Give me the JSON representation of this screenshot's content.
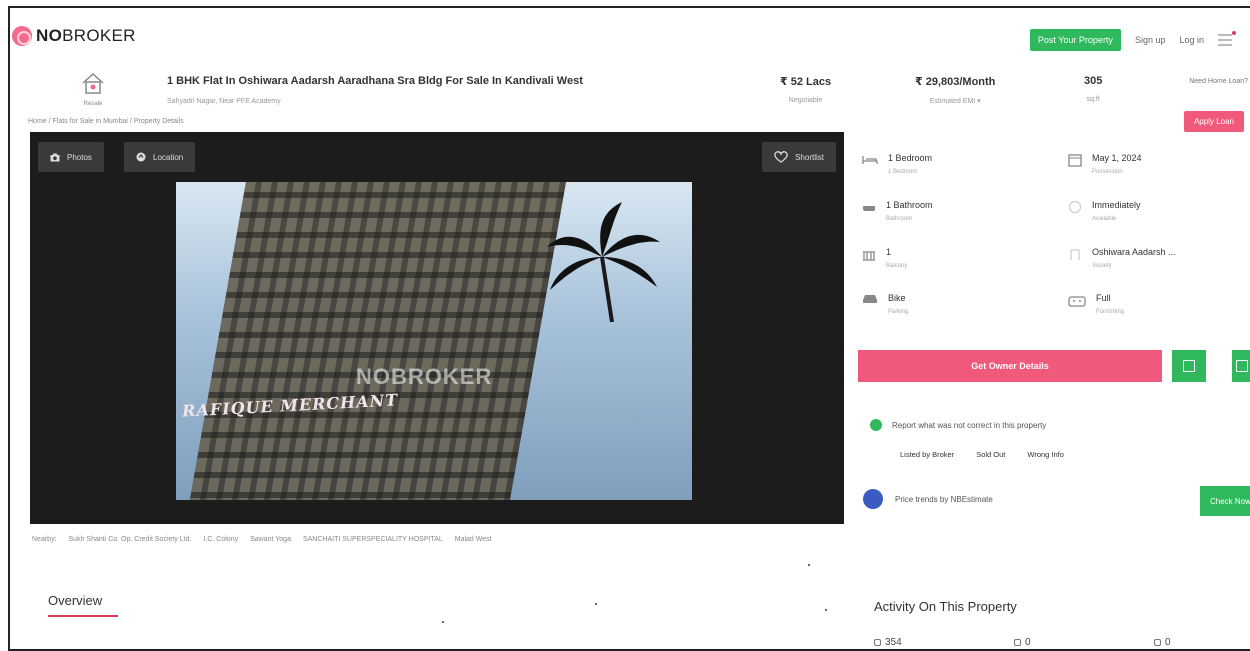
{
  "header": {
    "logo_bold": "NO",
    "logo_rest": "BROKER",
    "post_property": "Post Your Property",
    "sign_up": "Sign up",
    "log_in": "Log in"
  },
  "property": {
    "home_label": "Resale",
    "title": "1 BHK Flat In Oshiwara Aadarsh Aaradhana Sra Bldg For Sale In Kandivali West",
    "subtitle": "Sahyadri Nagar, Near PFE Academy",
    "price": "₹ 52 Lacs",
    "price_sub": "Negotiable",
    "emi": "₹ 29,803/Month",
    "emi_sub": "Estimated EMI ▾",
    "area": "305",
    "area_sub": "sq.ft",
    "loan_question": "Need Home Loan?",
    "apply_loan": "Apply Loan"
  },
  "breadcrumb": "Home / Flats for Sale in Mumbai / Property Details",
  "gallery": {
    "photos": "Photos",
    "location": "Location",
    "shortlist": "Shortlist",
    "watermark": "NOBROKER",
    "signature": "RAFIQUE MERCHANT"
  },
  "nearby": {
    "label": "Nearby:",
    "items": [
      "Sukh Shanti Co. Op. Credit Society Ltd.",
      "I.C. Colony",
      "Sawant Yoga",
      "SANCHAITI SUPERSPECIALITY HOSPITAL",
      "Malad West"
    ]
  },
  "overview": "Overview",
  "features": [
    {
      "title": "1 Bedroom",
      "sub": "1 Bedroom"
    },
    {
      "title": "May 1, 2024",
      "sub": "Possession"
    },
    {
      "title": "1 Bathroom",
      "sub": "Bathroom"
    },
    {
      "title": "Immediately",
      "sub": "Available"
    },
    {
      "title": "1",
      "sub": "Balcony"
    },
    {
      "title": "Oshiwara Aadarsh ...",
      "sub": "Society"
    },
    {
      "title": "Bike",
      "sub": "Parking"
    },
    {
      "title": "Full",
      "sub": "Furnishing"
    }
  ],
  "actions": {
    "owner_details": "Get Owner Details"
  },
  "report": {
    "text": "Report what was not correct in this property",
    "tags": [
      "Listed by Broker",
      "Sold Out",
      "Wrong Info"
    ]
  },
  "price_trend": {
    "text": "Price trends by NBEstimate",
    "button": "Check Now"
  },
  "activity": {
    "title": "Activity On This Property",
    "views": "354",
    "shortlists": "0",
    "contacts": "0"
  }
}
